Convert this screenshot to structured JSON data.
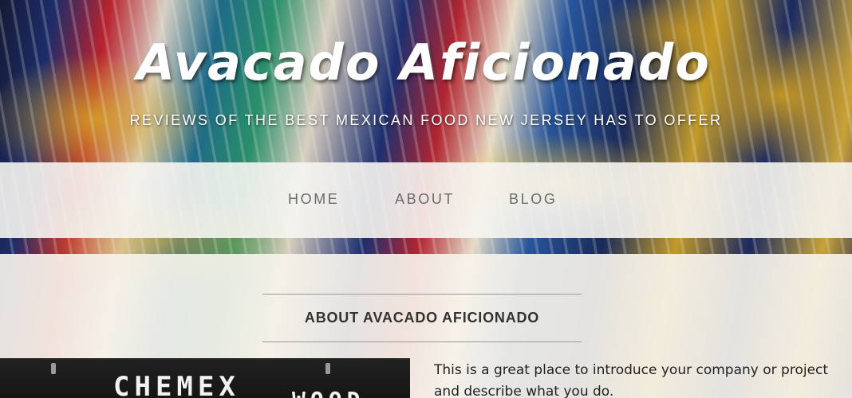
{
  "header": {
    "title": "Avacado Aficionado",
    "tagline": "REVIEWS OF THE BEST MEXICAN FOOD NEW JERSEY HAS TO OFFER"
  },
  "nav": {
    "items": [
      {
        "label": "HOME"
      },
      {
        "label": "ABOUT"
      },
      {
        "label": "BLOG"
      }
    ]
  },
  "about": {
    "heading_prefix": "ABOUT",
    "heading_strong": "AVACADO AFICIONADO",
    "intro_text": "This is a great place to introduce your company or project and describe what you do.",
    "photo_sign_left": "CHEMEX",
    "photo_sign_right": "WOOD"
  },
  "colors": {
    "nav_text": "#6b6b6b",
    "heading_text": "#333333",
    "body_text": "#222222",
    "nav_bg": "#f6f5f1",
    "content_bg": "#f6f3ec"
  }
}
